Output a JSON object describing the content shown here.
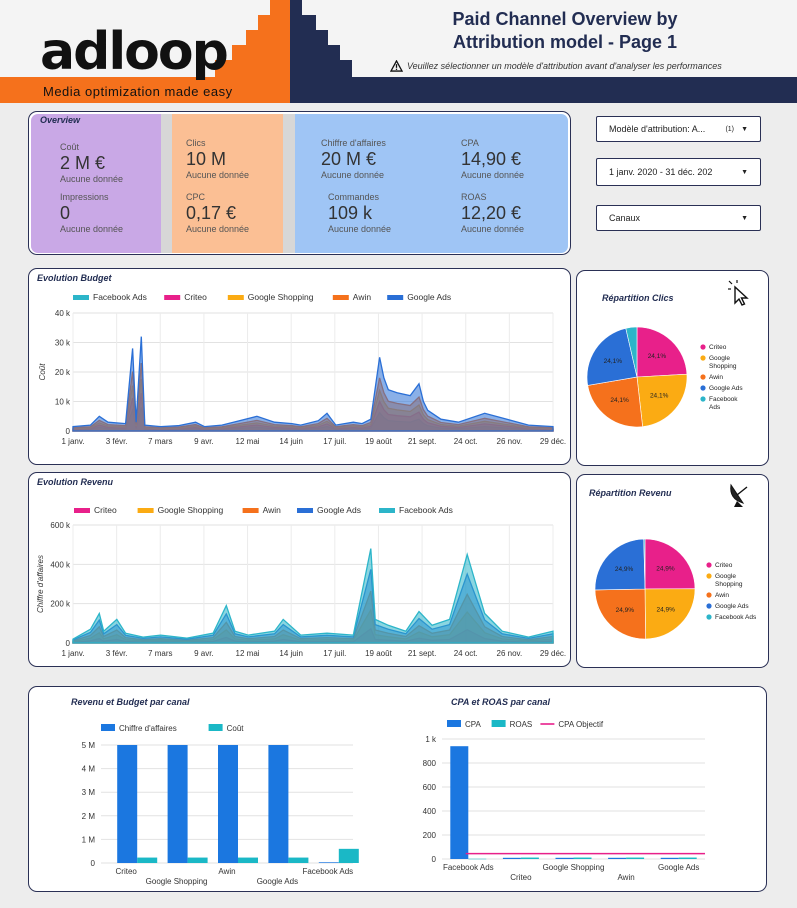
{
  "header": {
    "logo_text": "adloop",
    "tagline": "Media optimization made easy",
    "title_line1": "Paid Channel Overview by",
    "title_line2": "Attribution model - Page 1",
    "warning": "Veuillez sélectionner un modèle d'attribution avant d'analyser les performances"
  },
  "overview": {
    "title": "Overview",
    "kpis": {
      "cout": {
        "label": "Coût",
        "value": "2 M €",
        "sub": "Aucune donnée"
      },
      "impressions": {
        "label": "Impressions",
        "value": "0",
        "sub": "Aucune donnée"
      },
      "clics": {
        "label": "Clics",
        "value": "10 M",
        "sub": "Aucune donnée"
      },
      "cpc": {
        "label": "CPC",
        "value": "0,17 €",
        "sub": "Aucune donnée"
      },
      "ca": {
        "label": "Chiffre d'affaires",
        "value": "20 M €",
        "sub": "Aucune donnée"
      },
      "commandes": {
        "label": "Commandes",
        "value": "109 k",
        "sub": "Aucune donnée"
      },
      "cpa": {
        "label": "CPA",
        "value": "14,90 €",
        "sub": "Aucune donnée"
      },
      "roas": {
        "label": "ROAS",
        "value": "12,20 €",
        "sub": "Aucune donnée"
      }
    },
    "colors": {
      "purple": "#c9a8e6",
      "orange": "#fbbf94",
      "blue": "#9fc5f5",
      "gray": "#d7d7d7"
    }
  },
  "controls": {
    "attribution_label": "Modèle d'attribution: A...",
    "attribution_count": "(1)",
    "date_range": "1 janv. 2020 - 31 déc. 202",
    "canaux": "Canaux"
  },
  "chart_data": [
    {
      "id": "evolution-budget",
      "type": "area",
      "title": "Evolution Budget",
      "ylabel": "Coût",
      "ylim": [
        0,
        40000
      ],
      "yticks": [
        "0",
        "10 k",
        "20 k",
        "30 k",
        "40 k"
      ],
      "xticks": [
        "1 janv.",
        "3 févr.",
        "7 mars",
        "9 avr.",
        "12 mai",
        "14 juin",
        "17 juil.",
        "19 août",
        "21 sept.",
        "24 oct.",
        "26 nov.",
        "29 déc."
      ],
      "legend": [
        "Facebook Ads",
        "Criteo",
        "Google Shopping",
        "Awin",
        "Google Ads"
      ],
      "series_colors": [
        "#2cb5c9",
        "#e8208a",
        "#fbab13",
        "#f5711c",
        "#2a6fd6"
      ],
      "points": [
        [
          0,
          1500
        ],
        [
          20,
          2000
        ],
        [
          30,
          5000
        ],
        [
          40,
          3000
        ],
        [
          60,
          2500
        ],
        [
          68,
          28000
        ],
        [
          72,
          3000
        ],
        [
          78,
          32000
        ],
        [
          82,
          2000
        ],
        [
          100,
          1500
        ],
        [
          120,
          1800
        ],
        [
          140,
          3000
        ],
        [
          150,
          1500
        ],
        [
          170,
          2000
        ],
        [
          190,
          3500
        ],
        [
          210,
          5000
        ],
        [
          230,
          3000
        ],
        [
          250,
          2500
        ],
        [
          260,
          2000
        ],
        [
          280,
          3500
        ],
        [
          290,
          6000
        ],
        [
          300,
          2000
        ],
        [
          310,
          2500
        ],
        [
          320,
          3000
        ],
        [
          330,
          2500
        ],
        [
          340,
          4000
        ],
        [
          350,
          25000
        ],
        [
          355,
          18000
        ],
        [
          360,
          14000
        ],
        [
          370,
          13000
        ],
        [
          385,
          12000
        ],
        [
          395,
          16000
        ],
        [
          400,
          10000
        ],
        [
          405,
          7000
        ],
        [
          420,
          4000
        ],
        [
          440,
          3000
        ],
        [
          470,
          6000
        ],
        [
          520,
          2000
        ],
        [
          548,
          1500
        ]
      ],
      "date_axis_note": ""
    },
    {
      "id": "evolution-revenu",
      "type": "area",
      "title": "Evolution Revenu",
      "ylabel": "Chiffre d'affaires",
      "ylim": [
        0,
        600000
      ],
      "yticks": [
        "0",
        "200 k",
        "400 k",
        "600 k"
      ],
      "xticks": [
        "1 janv.",
        "3 févr.",
        "7 mars",
        "9 avr.",
        "12 mai",
        "14 juin",
        "17 juil.",
        "19 août",
        "21 sept.",
        "24 oct.",
        "26 nov.",
        "29 déc."
      ],
      "legend": [
        "Criteo",
        "Google Shopping",
        "Awin",
        "Google Ads",
        "Facebook Ads"
      ],
      "series_colors": [
        "#e8208a",
        "#fbab13",
        "#f5711c",
        "#2a6fd6",
        "#2cb5c9"
      ],
      "points": [
        [
          0,
          20000
        ],
        [
          20,
          70000
        ],
        [
          30,
          150000
        ],
        [
          35,
          60000
        ],
        [
          50,
          120000
        ],
        [
          60,
          50000
        ],
        [
          80,
          30000
        ],
        [
          100,
          40000
        ],
        [
          130,
          25000
        ],
        [
          160,
          50000
        ],
        [
          175,
          190000
        ],
        [
          185,
          60000
        ],
        [
          200,
          40000
        ],
        [
          230,
          60000
        ],
        [
          240,
          120000
        ],
        [
          260,
          40000
        ],
        [
          290,
          50000
        ],
        [
          320,
          40000
        ],
        [
          340,
          480000
        ],
        [
          345,
          120000
        ],
        [
          360,
          90000
        ],
        [
          380,
          60000
        ],
        [
          395,
          160000
        ],
        [
          410,
          90000
        ],
        [
          430,
          120000
        ],
        [
          450,
          450000
        ],
        [
          460,
          300000
        ],
        [
          470,
          150000
        ],
        [
          490,
          60000
        ],
        [
          520,
          30000
        ],
        [
          548,
          60000
        ]
      ]
    },
    {
      "id": "repartition-clics",
      "type": "pie",
      "title": "Répartition Clics",
      "labels": [
        "Criteo",
        "Google Shopping",
        "Awin",
        "Google Ads",
        "Facebook Ads"
      ],
      "legend_lines": [
        [
          "Criteo"
        ],
        [
          "Google",
          "Shopping"
        ],
        [
          "Awin"
        ],
        [
          "Google Ads"
        ],
        [
          "Facebook",
          "Ads"
        ]
      ],
      "values": [
        24.1,
        24.1,
        24.1,
        24.1,
        3.6
      ],
      "data_labels": [
        "24,1%",
        "24,1%",
        "24,1%",
        "24,1%",
        ""
      ],
      "colors": [
        "#e8208a",
        "#fbab13",
        "#f5711c",
        "#2a6fd6",
        "#2cb5c9"
      ]
    },
    {
      "id": "repartition-revenu",
      "type": "pie",
      "title": "Répartition Revenu",
      "labels": [
        "Criteo",
        "Google Shopping",
        "Awin",
        "Google Ads",
        "Facebook Ads"
      ],
      "legend_lines": [
        [
          "Criteo"
        ],
        [
          "Google",
          "Shopping"
        ],
        [
          "Awin"
        ],
        [
          "Google Ads"
        ],
        [
          "Facebook Ads"
        ]
      ],
      "values": [
        24.9,
        24.9,
        24.9,
        24.9,
        0.4
      ],
      "data_labels": [
        "24,9%",
        "24,9%",
        "24,9%",
        "24,9%",
        ""
      ],
      "colors": [
        "#e8208a",
        "#fbab13",
        "#f5711c",
        "#2a6fd6",
        "#2cb5c9"
      ]
    },
    {
      "id": "revenu-budget-canal",
      "type": "bar",
      "title": "Revenu et Budget par canal",
      "categories": [
        "Criteo",
        "Google Shopping",
        "Awin",
        "Google Ads",
        "Facebook Ads"
      ],
      "series": [
        {
          "name": "Chiffre d'affaires",
          "color": "#1b77e0",
          "values": [
            5000000,
            5000000,
            5000000,
            5000000,
            30000
          ]
        },
        {
          "name": "Coût",
          "color": "#1ab8c6",
          "values": [
            230000,
            230000,
            230000,
            230000,
            600000
          ]
        }
      ],
      "ylim": [
        0,
        5000000
      ],
      "yticks": [
        "0",
        "1 M",
        "2 M",
        "3 M",
        "4 M",
        "5 M"
      ]
    },
    {
      "id": "cpa-roas-canal",
      "type": "bar",
      "title": "CPA et ROAS par canal",
      "categories": [
        "Facebook Ads",
        "Criteo",
        "Google Shopping",
        "Awin",
        "Google Ads"
      ],
      "series": [
        {
          "name": "CPA",
          "color": "#1b77e0",
          "values": [
            940,
            10,
            10,
            10,
            10
          ]
        },
        {
          "name": "ROAS",
          "color": "#1ab8c6",
          "values": [
            2,
            12,
            12,
            12,
            12
          ]
        },
        {
          "name": "CPA Objectif",
          "color": "#e8208a",
          "values": [
            45,
            45,
            45,
            45,
            45
          ]
        }
      ],
      "ylim": [
        0,
        1000
      ],
      "yticks": [
        "0",
        "200",
        "400",
        "600",
        "800",
        "1 k"
      ]
    }
  ]
}
